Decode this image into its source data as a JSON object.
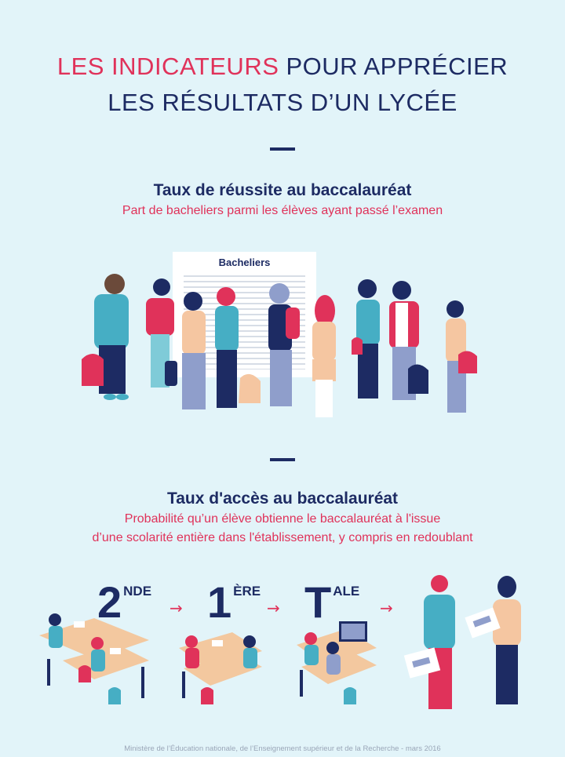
{
  "title": {
    "accent": "LES INDICATEURS",
    "rest_line1": " POUR APPRÉCIER",
    "line2": "LES RÉSULTATS D’UN LYCÉE"
  },
  "section1": {
    "heading": "Taux de réussite au baccalauréat",
    "subtitle": "Part de bacheliers parmi les élèves ayant passé l’examen",
    "board_label": "Bacheliers"
  },
  "section2": {
    "heading": "Taux d'accès au baccalauréat",
    "subtitle_line1": "Probabilité qu’un élève obtienne le baccalauréat à l'issue",
    "subtitle_line2": "d’une scolarité entière dans l'établissement, y compris en redoublant",
    "grades": [
      {
        "big": "2",
        "sup": "NDE"
      },
      {
        "big": "1",
        "sup": "ÈRE"
      },
      {
        "big": "T",
        "sup": "ALE"
      }
    ],
    "arrow": "→"
  },
  "footer": "Ministère de l’Éducation nationale, de l’Enseignement supérieur et de la Recherche - mars 2016",
  "colors": {
    "background": "#e2f4f9",
    "navy": "#1d2b63",
    "accent": "#e0325a",
    "teal": "#46aec4",
    "skin": "#f5c6a1"
  }
}
